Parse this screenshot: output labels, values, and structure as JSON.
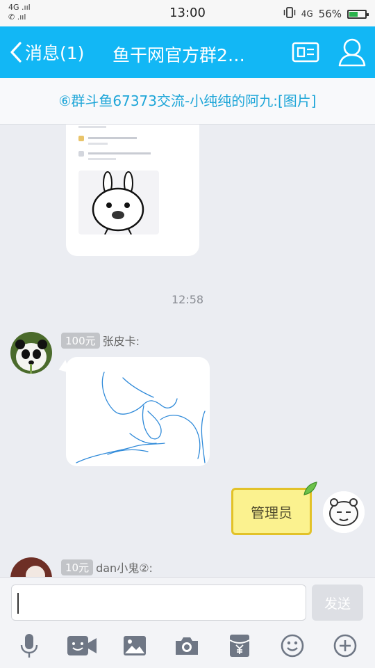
{
  "status_bar": {
    "network_top": "4G .ııl",
    "network_bottom": "✆ .ııl",
    "time": "13:00",
    "network_right": "4G",
    "battery_percent": "56%",
    "battery_level": 0.56
  },
  "nav": {
    "back_label": "消息(1)",
    "title": "鱼干网官方群2…",
    "back_icon": "chevron-left-icon",
    "card_icon": "id-card-icon",
    "person_icon": "person-icon"
  },
  "notice": {
    "text": "⑥群斗鱼67373交流-小纯纯的阿九:[图片]"
  },
  "chat": {
    "time_divider": "12:58",
    "messages": [
      {
        "badge": "100元",
        "sender": "张皮卡:"
      },
      {
        "badge": "10元",
        "sender": "dan小鬼②:"
      }
    ],
    "admin_label": "管理员"
  },
  "input": {
    "value": "",
    "send_label": "发送"
  },
  "toolbar": {
    "icons": [
      "microphone-icon",
      "video-call-icon",
      "image-icon",
      "camera-icon",
      "red-packet-icon",
      "emoji-icon",
      "plus-icon"
    ]
  },
  "colors": {
    "nav": "#12b7f5",
    "notice_text": "#1fa6d8",
    "background": "#ebedf2",
    "battery": "#2bb24c"
  }
}
